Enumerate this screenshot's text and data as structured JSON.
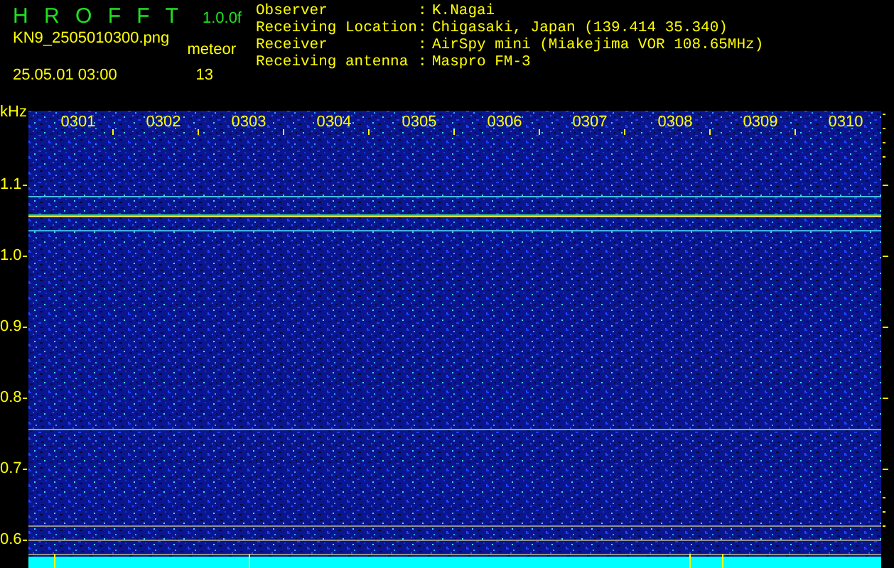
{
  "header": {
    "title": "H R O F F T",
    "version": "1.0.0f",
    "filename": "KN9_2505010300.png",
    "count_label": "meteor",
    "datetime": "25.05.01 03:00",
    "count": "13"
  },
  "info": [
    {
      "label": "Observer",
      "separator": ":",
      "value": "K.Nagai"
    },
    {
      "label": "Receiving Location",
      "separator": ":",
      "value": "Chigasaki, Japan (139.414 35.340)"
    },
    {
      "label": "Receiver",
      "separator": ":",
      "value": "AirSpy mini (Miakejima VOR 108.65MHz)"
    },
    {
      "label": "Receiving antenna",
      "separator": ":",
      "value": "Maspro FM-3"
    }
  ],
  "plot": {
    "unit": "kHz",
    "y_labels": [
      "1.1",
      "1.0",
      "0.9",
      "0.8",
      "0.7",
      "0.6"
    ],
    "time_labels": [
      "0301",
      "0302",
      "0303",
      "0304",
      "0305",
      "0306",
      "0307",
      "0308",
      "0309",
      "0310"
    ]
  }
}
